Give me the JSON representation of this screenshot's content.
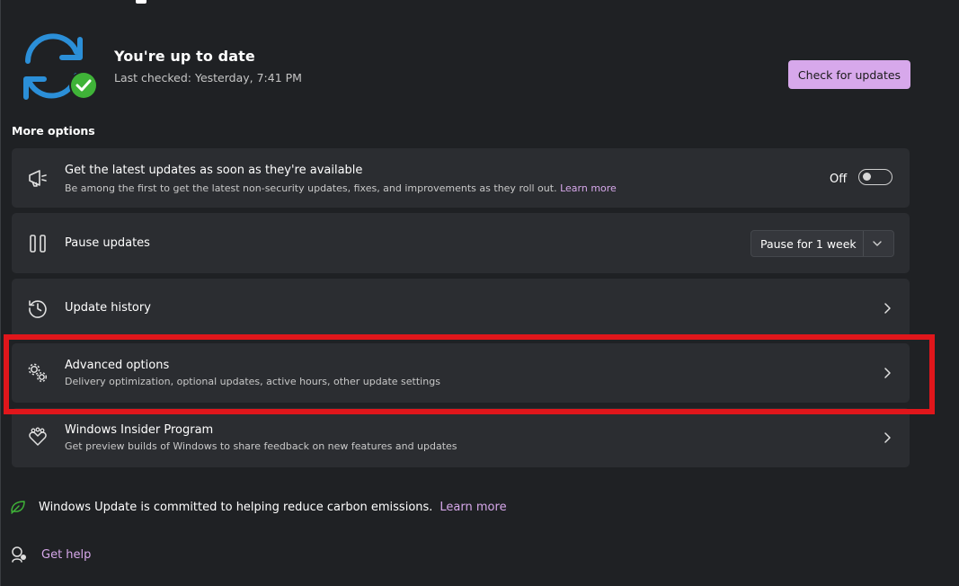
{
  "status": {
    "title": "You're up to date",
    "last_checked": "Last checked: Yesterday, 7:41 PM",
    "check_button": "Check for updates"
  },
  "more_options": {
    "label": "More options",
    "latest_updates": {
      "title": "Get the latest updates as soon as they're available",
      "description": "Be among the first to get the latest non-security updates, fixes, and improvements as they roll out.",
      "learn_more": "Learn more",
      "toggle_state": "Off"
    },
    "pause_updates": {
      "title": "Pause updates",
      "selected": "Pause for 1 week"
    },
    "update_history": {
      "title": "Update history"
    },
    "advanced_options": {
      "title": "Advanced options",
      "description": "Delivery optimization, optional updates, active hours, other update settings"
    },
    "insider_program": {
      "title": "Windows Insider Program",
      "description": "Get preview builds of Windows to share feedback on new features and updates"
    }
  },
  "footer": {
    "carbon_text": "Windows Update is committed to helping reduce carbon emissions.",
    "carbon_learn_more": "Learn more",
    "get_help": "Get help"
  },
  "colors": {
    "accent": "#d7a8eb",
    "highlight": "#e0161b",
    "success": "#3fb338",
    "sync_blue": "#2b8fd8"
  }
}
